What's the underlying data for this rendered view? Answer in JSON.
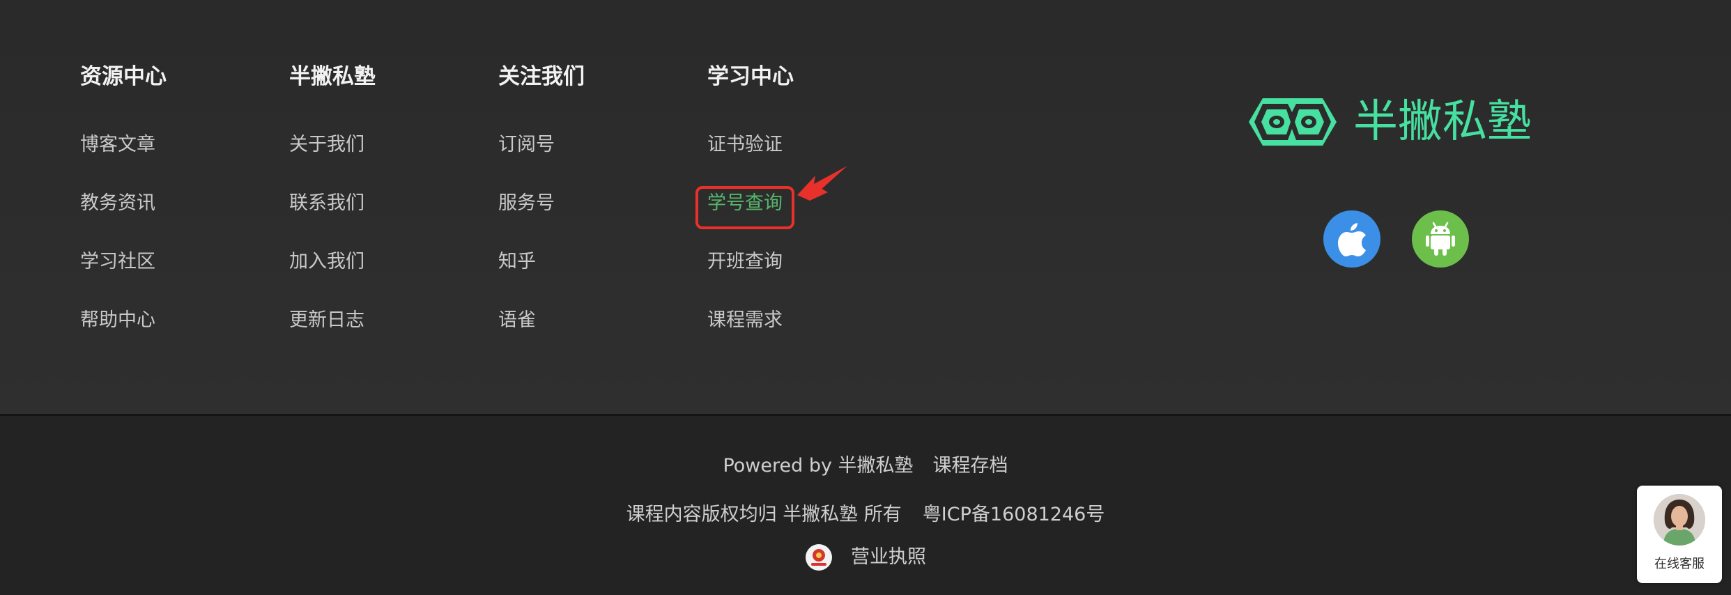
{
  "columns": [
    {
      "title": "资源中心",
      "items": [
        "博客文章",
        "教务资讯",
        "学习社区",
        "帮助中心"
      ]
    },
    {
      "title": "半撇私塾",
      "items": [
        "关于我们",
        "联系我们",
        "加入我们",
        "更新日志"
      ]
    },
    {
      "title": "关注我们",
      "items": [
        "订阅号",
        "服务号",
        "知乎",
        "语雀"
      ]
    },
    {
      "title": "学习中心",
      "items": [
        "证书验证",
        "学号查询",
        "开班查询",
        "课程需求"
      ],
      "active_item": "学号查询"
    }
  ],
  "brand": {
    "name": "半撇私塾",
    "logo_icon": "owl-mask-logo-icon",
    "color": "#46e0a0"
  },
  "apps": [
    {
      "name": "apple-icon",
      "color": "#3b8fe6"
    },
    {
      "name": "android-icon",
      "color": "#6cbf4a"
    }
  ],
  "footer": {
    "powered_by": "Powered by 半撇私塾",
    "archive_link": "课程存档",
    "copyright": "课程内容版权均归 半撇私塾 所有",
    "icp": "粤ICP备16081246号",
    "license": "营业执照",
    "license_icon": "emblem-icon"
  },
  "customer_service": {
    "label": "在线客服",
    "avatar_icon": "agent-avatar"
  },
  "annotation": {
    "highlight_color": "#e8312a"
  }
}
